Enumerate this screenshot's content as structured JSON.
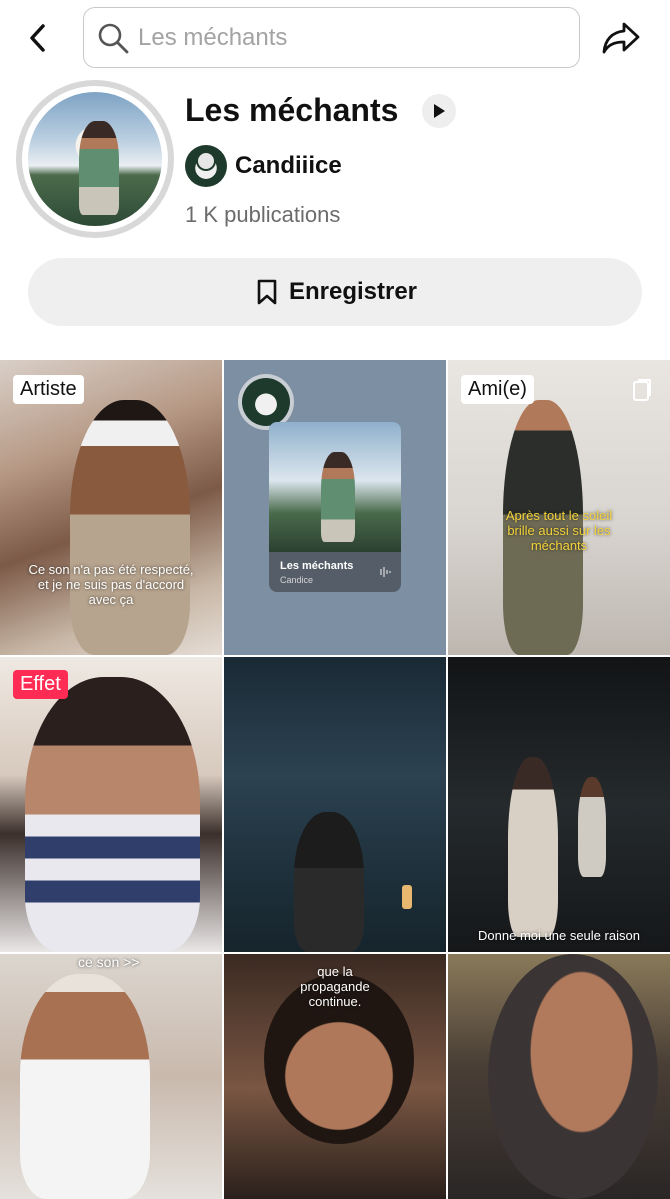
{
  "search": {
    "placeholder": "Les méchants"
  },
  "sound": {
    "title": "Les méchants",
    "creator": "Candiiice",
    "publications": "1 K publications"
  },
  "actions": {
    "save_label": "Enregistrer"
  },
  "icons": {
    "back": "back-arrow-icon",
    "search": "search-icon",
    "share": "share-icon",
    "play": "play-icon",
    "bookmark": "bookmark-icon"
  },
  "colors": {
    "effect_badge": "#fe2c55",
    "subtitle_yellow": "#f2d23c"
  },
  "videos": [
    {
      "badge": "Artiste",
      "caption": "Ce son n'a pas été respecté, et je ne suis pas d'accord avec ça"
    },
    {
      "music_card_title": "Les méchants",
      "music_card_artist": "Candice"
    },
    {
      "badge": "Ami(e)",
      "caption": "Après tout le soleil brille aussi sur les méchants"
    },
    {
      "badge": "Effet"
    },
    {},
    {
      "caption": "Donne moi une seule raison"
    },
    {
      "caption": "ce son >>"
    },
    {
      "caption": "que la propagande continue."
    },
    {}
  ]
}
